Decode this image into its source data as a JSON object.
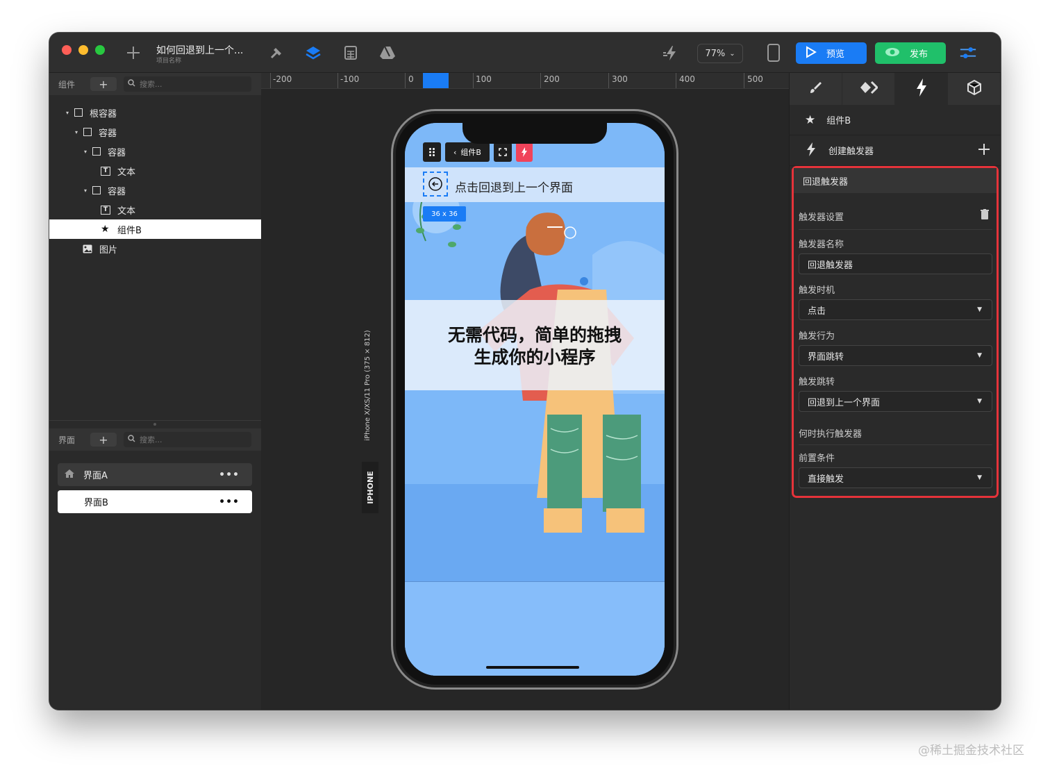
{
  "titlebar": {
    "doc_title": "如何回退到上一个...",
    "doc_subtitle": "项目名称",
    "zoom": "77%",
    "preview_label": "预览",
    "publish_label": "发布"
  },
  "components_panel": {
    "title": "组件",
    "search_placeholder": "搜索...",
    "tree": [
      {
        "label": "根容器"
      },
      {
        "label": "容器"
      },
      {
        "label": "容器"
      },
      {
        "label": "文本"
      },
      {
        "label": "容器"
      },
      {
        "label": "文本"
      },
      {
        "label": "组件B"
      },
      {
        "label": "图片"
      }
    ]
  },
  "pages_panel": {
    "title": "界面",
    "search_placeholder": "搜索...",
    "pages": [
      {
        "label": "界面A"
      },
      {
        "label": "界面B"
      }
    ]
  },
  "ruler": {
    "ticks": [
      "-200",
      "-100",
      "0",
      "100",
      "200",
      "300",
      "400",
      "500"
    ]
  },
  "device": {
    "type_label": "IPHONE",
    "model_label": "iPhone X/XS/11 Pro (375 × 812)"
  },
  "phone": {
    "toolbar_component": "组件B",
    "page_title": "点击回退到上一个界面",
    "size_tag": "36 x 36",
    "hero_line1": "无需代码，简单的拖拽",
    "hero_line2": "生成你的小程序"
  },
  "inspector": {
    "component_name": "组件B",
    "create_trigger": "创建触发器",
    "section_title": "回退触发器",
    "settings_label": "触发器设置",
    "name_label": "触发器名称",
    "name_value": "回退触发器",
    "timing_label": "触发时机",
    "timing_value": "点击",
    "action_label": "触发行为",
    "action_value": "界面跳转",
    "jump_label": "触发跳转",
    "jump_value": "回退到上一个界面",
    "when_label": "何时执行触发器",
    "condition_label": "前置条件",
    "condition_value": "直接触发"
  },
  "watermark": "@稀土掘金技术社区",
  "colors": {
    "accent_blue": "#1a7cf5",
    "publish_green": "#20c06a",
    "highlight_red": "#e5333a"
  }
}
